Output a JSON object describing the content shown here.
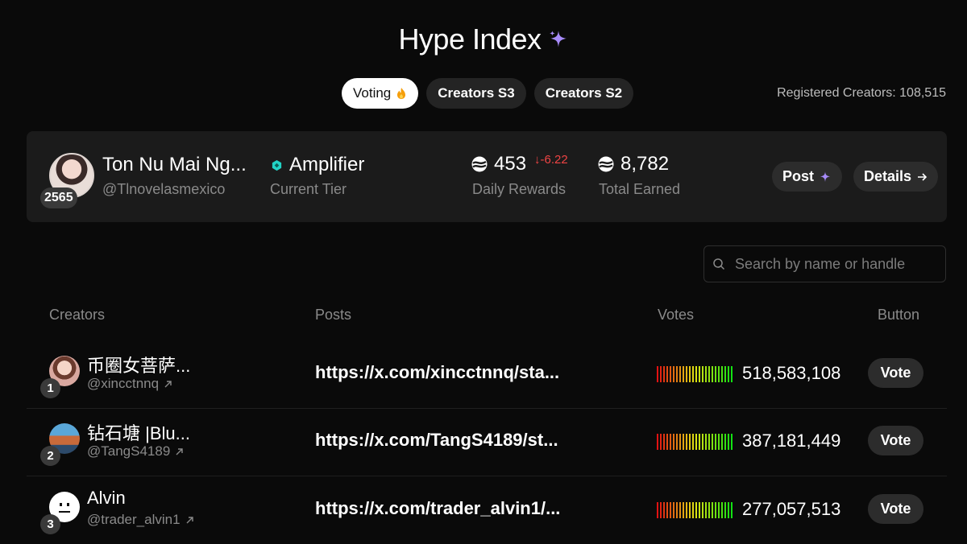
{
  "header": {
    "title": "Hype Index",
    "icon": "sparkle-icon"
  },
  "tabs": [
    {
      "label": "Voting",
      "icon": "flame-icon",
      "active": true
    },
    {
      "label": "Creators S3",
      "active": false
    },
    {
      "label": "Creators S2",
      "active": false
    }
  ],
  "registered": "Registered Creators: 108,515",
  "me": {
    "rank": "2565",
    "name": "Ton Nu Mai Ng...",
    "handle": "@Tlnovelasmexico",
    "tier": "Amplifier",
    "tier_label": "Current Tier",
    "daily_rewards": "453",
    "daily_delta": "↓-6.22",
    "daily_label": "Daily Rewards",
    "total_earned": "8,782",
    "total_label": "Total Earned",
    "post_label": "Post",
    "details_label": "Details"
  },
  "search": {
    "placeholder": "Search by name or handle"
  },
  "table": {
    "headers": {
      "creators": "Creators",
      "posts": "Posts",
      "votes": "Votes",
      "button": "Button"
    },
    "rows": [
      {
        "rank": "1",
        "name": "币圈女菩萨...",
        "handle": "@xincctnnq",
        "post": "https://x.com/xincctnnq/sta...",
        "votes": "518,583,108",
        "button": "Vote"
      },
      {
        "rank": "2",
        "name": "钻石塘 |Blu...",
        "handle": "@TangS4189",
        "post": "https://x.com/TangS4189/st...",
        "votes": "387,181,449",
        "button": "Vote"
      },
      {
        "rank": "3",
        "name": "Alvin",
        "handle": "@trader_alvin1",
        "post": "https://x.com/trader_alvin1/...",
        "votes": "277,057,513",
        "button": "Vote"
      }
    ]
  },
  "colors": {
    "background": "#0a0a0a",
    "card": "#1b1b1b",
    "sparkle": "#a78bfa",
    "tier": "#22d3c5",
    "negative": "#ef4444"
  }
}
